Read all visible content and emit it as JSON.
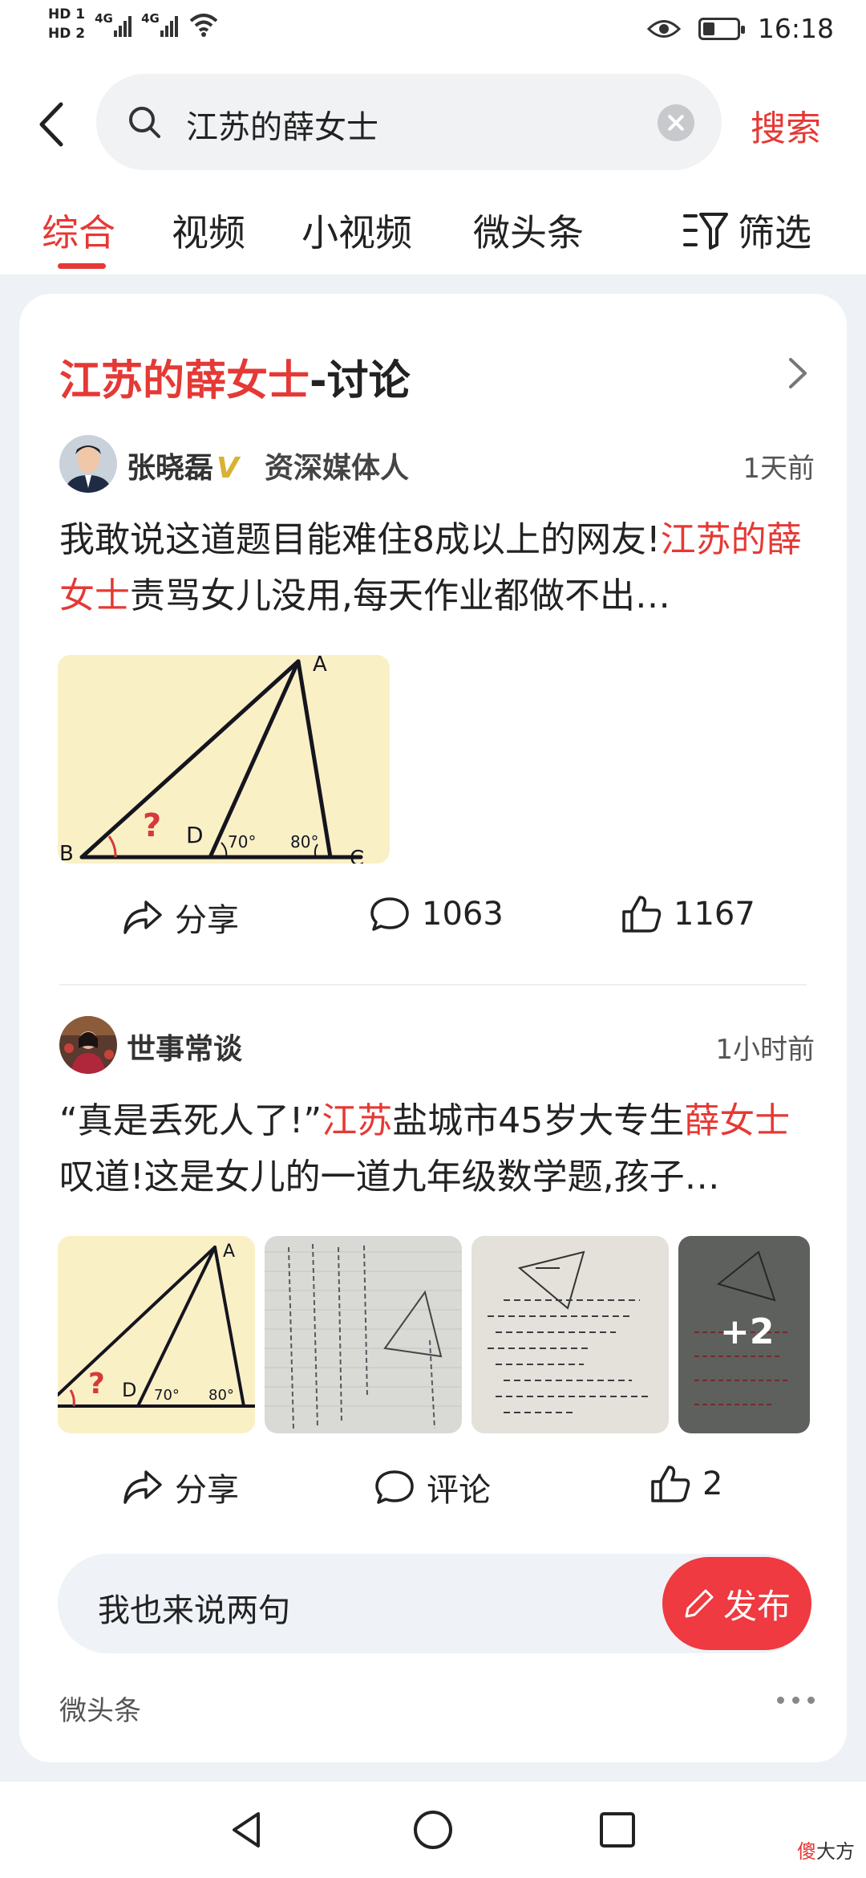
{
  "status_bar": {
    "hd1": "HD 1",
    "hd2": "HD 2",
    "net1": "4G",
    "net2": "4G",
    "time": "16:18"
  },
  "search": {
    "query": "江苏的薛女士",
    "button_label": "搜索"
  },
  "tabs": [
    {
      "label": "综合",
      "active": true
    },
    {
      "label": "视频",
      "active": false
    },
    {
      "label": "小视频",
      "active": false
    },
    {
      "label": "微头条",
      "active": false
    }
  ],
  "filter_label": "筛选",
  "card": {
    "title_highlight": "江苏的薛女士",
    "title_suffix": "-讨论",
    "posts": [
      {
        "author": "张晓磊",
        "verified_mark": "V",
        "role": "资深媒体人",
        "time": "1天前",
        "text_parts": [
          "我敢说这道题目能难住8成以上的网友!",
          "江苏的薛女士",
          "责骂女儿没用,每天作业都做不出…"
        ],
        "image_labels": {
          "a": "A",
          "b": "B",
          "c": "C",
          "d": "D",
          "q": "?",
          "angle1": "70°",
          "angle2": "80°"
        },
        "share_label": "分享",
        "comment_count": "1063",
        "like_count": "1167"
      },
      {
        "author": "世事常谈",
        "time": "1小时前",
        "text_parts": [
          "“真是丢死人了!”",
          "江苏",
          "盐城市45岁大专生",
          "薛女士",
          "叹道!这是女儿的一道九年级数学题,孩子…"
        ],
        "image_labels": {
          "a": "A",
          "d": "D",
          "q": "?",
          "angle1": "70°",
          "angle2": "80°"
        },
        "more_images": "+2",
        "share_label": "分享",
        "comment_label": "评论",
        "like_count": "2"
      }
    ],
    "input_placeholder": "我也来说两句",
    "publish_label": "发布",
    "source": "微头条"
  },
  "watermark": {
    "red": "傻",
    "black": "大方"
  },
  "colors": {
    "accent": "#e53935",
    "page_bg": "#eef1f5",
    "thumb_bg": "#faf0c6"
  },
  "icons": [
    "back-icon",
    "search-icon",
    "clear-icon",
    "filter-icon",
    "chevron-right-icon",
    "share-icon",
    "comment-icon",
    "like-icon",
    "pen-icon",
    "more-icon",
    "nav-back-icon",
    "nav-home-icon",
    "nav-recent-icon"
  ]
}
